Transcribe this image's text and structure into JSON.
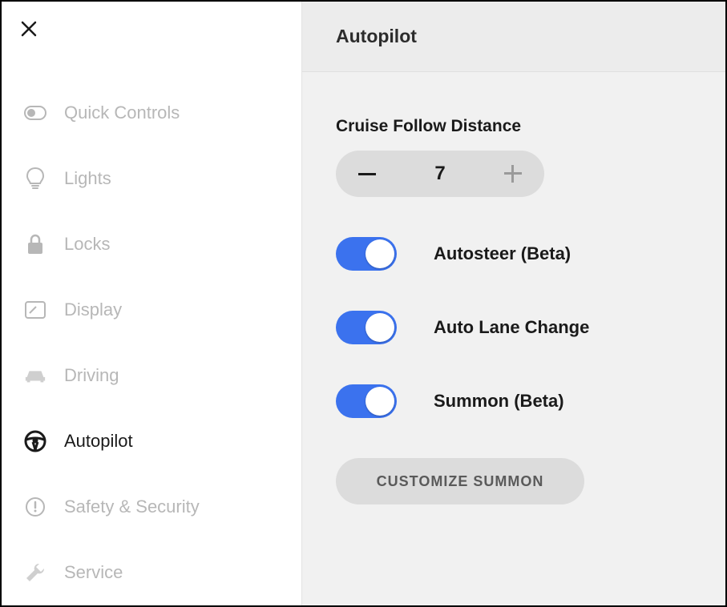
{
  "colors": {
    "accent": "#3b72ee",
    "inactive": "#b7b7b7",
    "text": "#1a1a1a",
    "pill": "#dcdcdc"
  },
  "sidebar": {
    "items": [
      {
        "label": "Quick Controls",
        "icon": "toggle-icon",
        "active": false
      },
      {
        "label": "Lights",
        "icon": "bulb-icon",
        "active": false
      },
      {
        "label": "Locks",
        "icon": "lock-icon",
        "active": false
      },
      {
        "label": "Display",
        "icon": "display-icon",
        "active": false
      },
      {
        "label": "Driving",
        "icon": "car-icon",
        "active": false
      },
      {
        "label": "Autopilot",
        "icon": "steering-icon",
        "active": true
      },
      {
        "label": "Safety & Security",
        "icon": "alert-icon",
        "active": false
      },
      {
        "label": "Service",
        "icon": "wrench-icon",
        "active": false
      }
    ]
  },
  "header": {
    "title": "Autopilot"
  },
  "main": {
    "cruise": {
      "label": "Cruise Follow Distance",
      "value": "7"
    },
    "toggles": [
      {
        "label": "Autosteer (Beta)",
        "on": true
      },
      {
        "label": "Auto Lane Change",
        "on": true
      },
      {
        "label": "Summon (Beta)",
        "on": true
      }
    ],
    "customize_label": "CUSTOMIZE SUMMON"
  }
}
